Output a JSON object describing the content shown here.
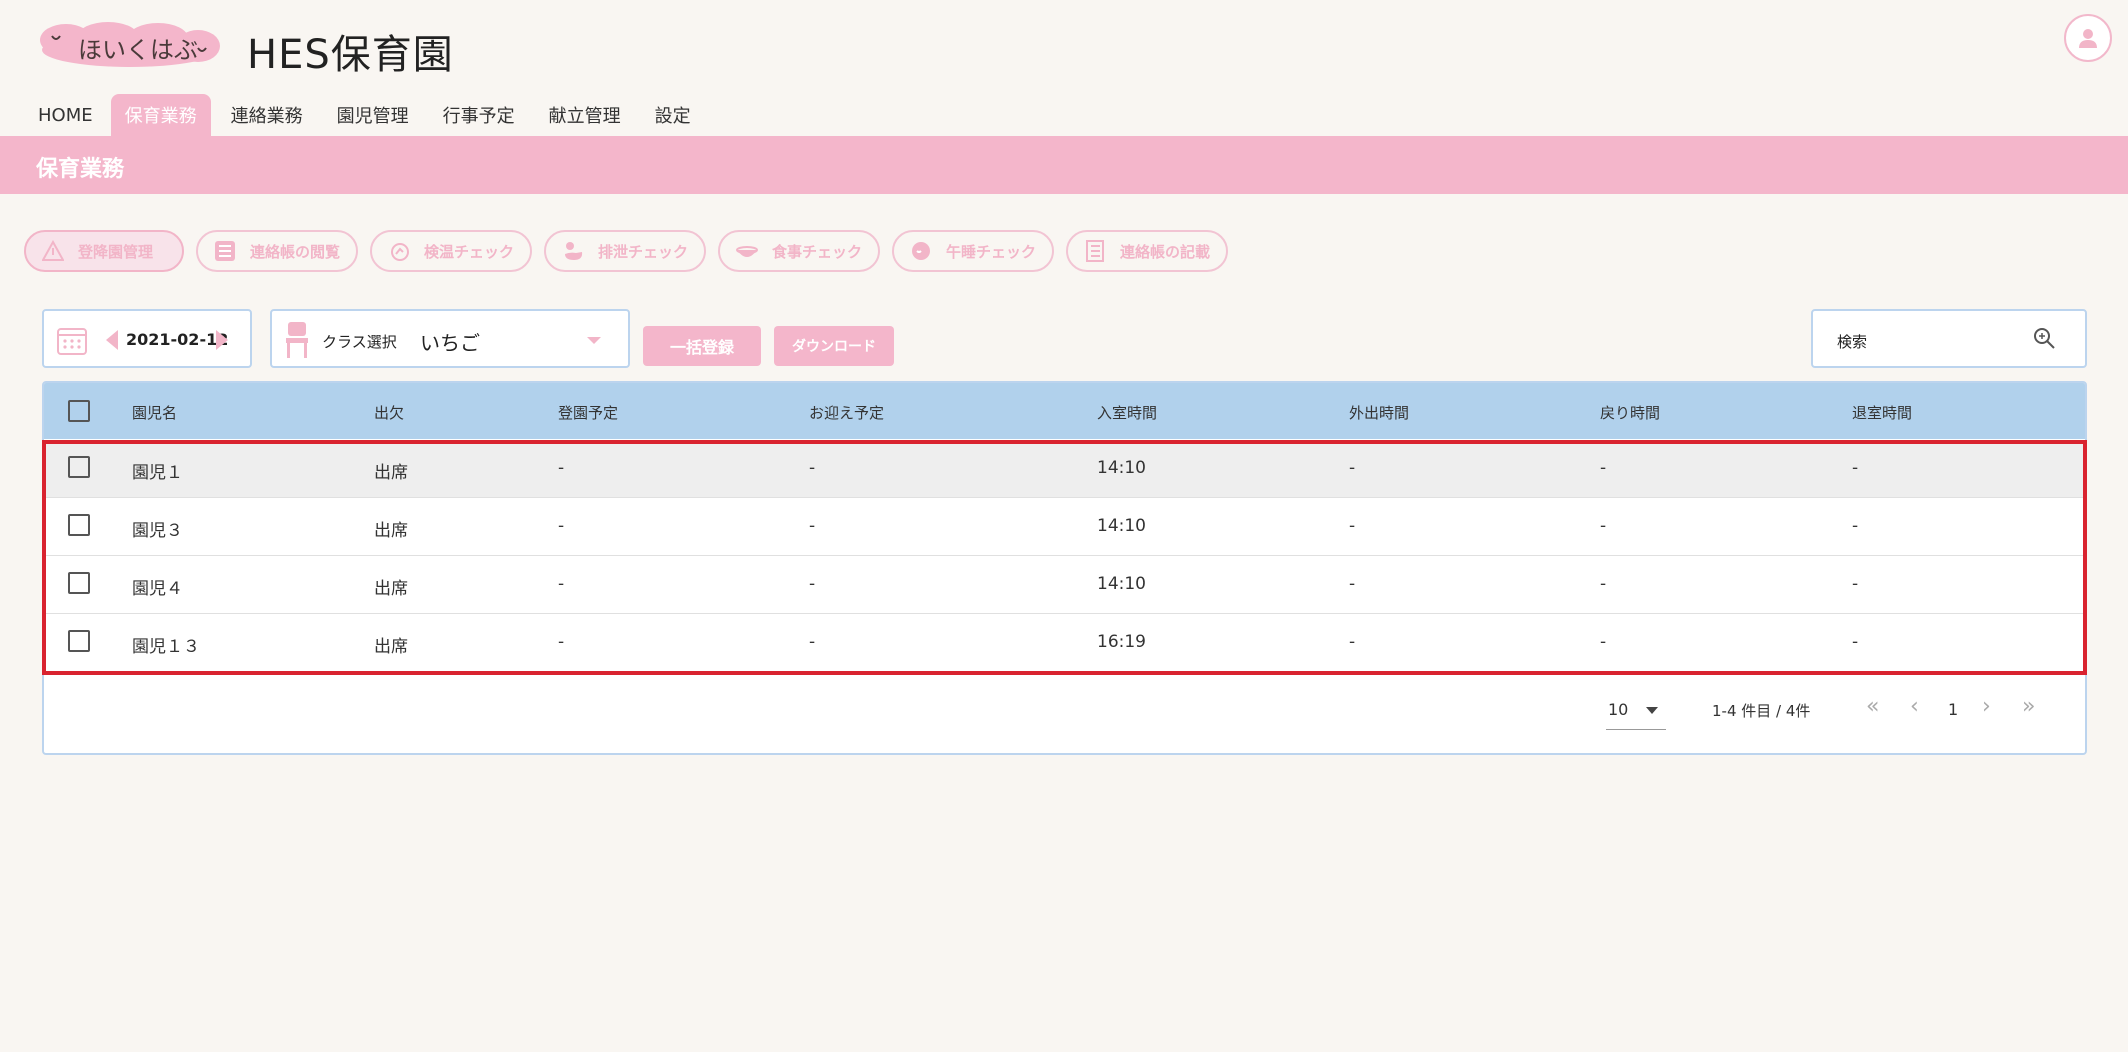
{
  "header": {
    "logo_text": "ほいくはぶ",
    "app_title": "HES保育園"
  },
  "nav": {
    "items": [
      "HOME",
      "保育業務",
      "連絡業務",
      "園児管理",
      "行事予定",
      "献立管理",
      "設定"
    ],
    "active": "保育業務"
  },
  "page_title": "保育業務",
  "functions": [
    {
      "label": "登降園管理",
      "icon": "warning-icon"
    },
    {
      "label": "連絡帳の閲覧",
      "icon": "list-icon"
    },
    {
      "label": "検温チェック",
      "icon": "thermometer-icon"
    },
    {
      "label": "排泄チェック",
      "icon": "duck-icon"
    },
    {
      "label": "食事チェック",
      "icon": "bowl-icon"
    },
    {
      "label": "午睡チェック",
      "icon": "sleep-icon"
    },
    {
      "label": "連絡帳の記載",
      "icon": "notebook-icon"
    }
  ],
  "toolbar": {
    "date": "2021-02-12",
    "class_label": "クラス選択",
    "class_value": "いちご",
    "bulk_register": "一括登録",
    "download": "ダウンロード",
    "search_placeholder": "検索"
  },
  "table": {
    "columns": [
      "園児名",
      "出欠",
      "登園予定",
      "お迎え予定",
      "入室時間",
      "外出時間",
      "戻り時間",
      "退室時間"
    ],
    "rows": [
      {
        "name": "園児１",
        "attendance": "出席",
        "arrival_plan": "-",
        "pickup_plan": "-",
        "entry": "14:10",
        "out": "-",
        "back": "-",
        "exit": "-"
      },
      {
        "name": "園児３",
        "attendance": "出席",
        "arrival_plan": "-",
        "pickup_plan": "-",
        "entry": "14:10",
        "out": "-",
        "back": "-",
        "exit": "-"
      },
      {
        "name": "園児４",
        "attendance": "出席",
        "arrival_plan": "-",
        "pickup_plan": "-",
        "entry": "14:10",
        "out": "-",
        "back": "-",
        "exit": "-"
      },
      {
        "name": "園児１３",
        "attendance": "出席",
        "arrival_plan": "-",
        "pickup_plan": "-",
        "entry": "16:19",
        "out": "-",
        "back": "-",
        "exit": "-"
      }
    ]
  },
  "pagination": {
    "per_page": "10",
    "range": "1-4 件目 / 4件",
    "current_page": "1"
  },
  "colors": {
    "accent_pink": "#f4b6cb",
    "header_blue": "#b1d1ec",
    "highlight_red": "#d9232f"
  }
}
